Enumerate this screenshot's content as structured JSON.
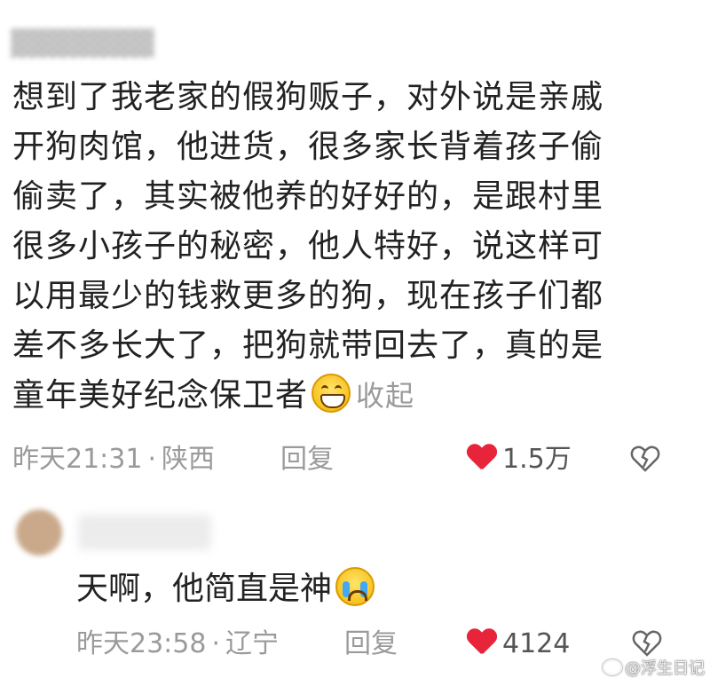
{
  "comment1": {
    "text_lines": [
      "想到了我老家的假狗贩子，对外说是亲戚",
      "开狗肉馆，他进货，很多家长背着孩子偷",
      "偷卖了，其实被他养的好好的，是跟村里",
      "很多小孩子的秘密，他人特好，说这样可",
      "以用最少的钱救更多的狗，现在孩子们都",
      "差不多长大了，把狗就带回去了，真的是",
      "童年美好纪念保卫者"
    ],
    "emoji": "grinning-face",
    "collapse_label": "收起",
    "time": "昨天21:31",
    "location": "陕西",
    "reply_label": "回复",
    "like_count": "1.5万",
    "dislike_icon": "broken-heart-icon"
  },
  "comment2": {
    "text": "天啊，他简直是神",
    "emoji": "crying-face",
    "time": "昨天23:58",
    "location": "辽宁",
    "reply_label": "回复",
    "like_count": "4124",
    "dislike_icon": "broken-heart-icon"
  },
  "watermark": {
    "text": "@浮生日记"
  },
  "colors": {
    "heart": "#e8243a",
    "meta_text": "#9a9a9a",
    "body_text": "#222222"
  }
}
